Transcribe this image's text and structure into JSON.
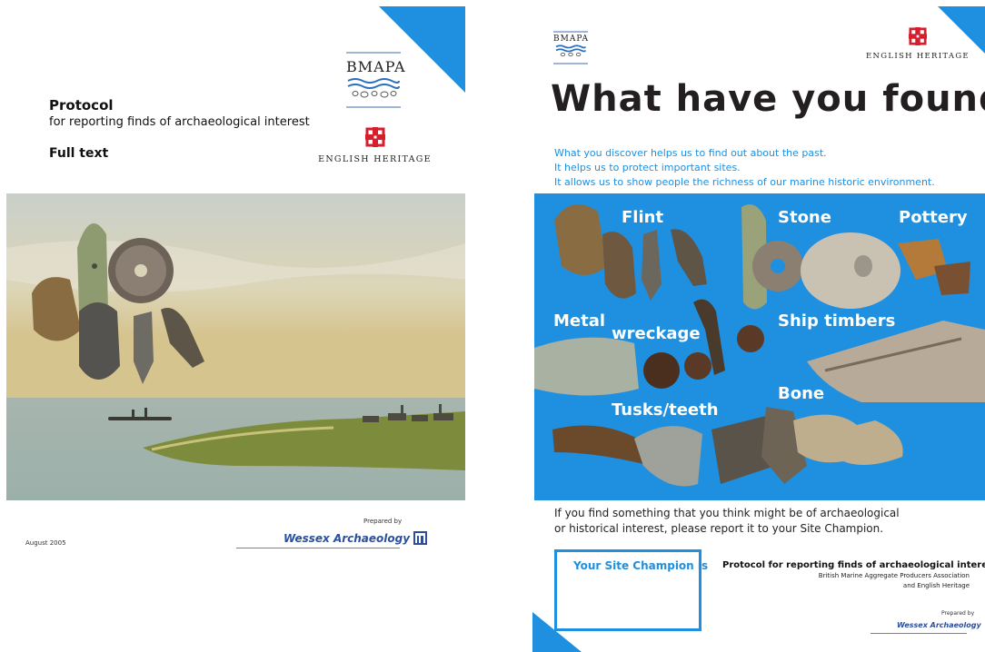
{
  "left_page": {
    "bmapa_logo": "BMAPA",
    "english_heritage_logo": "ENGLISH HERITAGE",
    "title": "Protocol",
    "subtitle": "for reporting finds of archaeological interest",
    "full_text": "Full text",
    "date": "August 2005",
    "prepared_by": "Prepared by",
    "wessex_archaeology": "Wessex Archaeology"
  },
  "right_page": {
    "bmapa_logo": "BMAPA",
    "english_heritage_logo": "ENGLISH HERITAGE",
    "headline": "What have you found?",
    "intro_lines": [
      "What you discover helps us to find out about the past.",
      "It helps us to protect important sites.",
      "It allows us to show people the richness of our marine historic environment."
    ],
    "find_labels": {
      "flint": "Flint",
      "stone": "Stone",
      "pottery": "Pottery",
      "metal": "Metal",
      "wreckage": "wreckage",
      "ship_timbers": "Ship timbers",
      "bone": "Bone",
      "tusks_teeth": "Tusks/teeth"
    },
    "report_lines": [
      "If you find something that you think might be of archaeological",
      "or historical interest, please report it to your Site Champion."
    ],
    "site_champion_label": "Your Site Champion is",
    "footer_title": "Protocol for reporting finds of archaeological interest",
    "footer_lines": [
      "British Marine Aggregate Producers Association",
      "and English Heritage"
    ],
    "prepared_by": "Prepared by",
    "wessex_archaeology": "Wessex Archaeology"
  },
  "colors": {
    "accent_blue": "#1f8fe0",
    "heading_dark": "#231f20",
    "english_heritage_red": "#d61f2c",
    "wessex_blue": "#2a4fa0"
  }
}
